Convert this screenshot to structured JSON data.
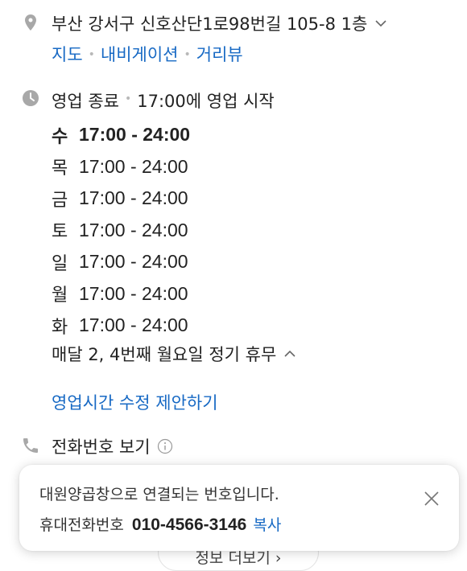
{
  "address": {
    "text": "부산 강서구 신호산단1로98번길 105-8 1층",
    "links": [
      "지도",
      "내비게이션",
      "거리뷰"
    ]
  },
  "business": {
    "status": "영업 종료",
    "next_open": "17:00에 영업 시작",
    "hours": [
      {
        "day": "수",
        "time": "17:00 - 24:00"
      },
      {
        "day": "목",
        "time": "17:00 - 24:00"
      },
      {
        "day": "금",
        "time": "17:00 - 24:00"
      },
      {
        "day": "토",
        "time": "17:00 - 24:00"
      },
      {
        "day": "일",
        "time": "17:00 - 24:00"
      },
      {
        "day": "월",
        "time": "17:00 - 24:00"
      },
      {
        "day": "화",
        "time": "17:00 - 24:00"
      }
    ],
    "closed_note": "매달 2, 4번째 월요일 정기 휴무",
    "suggest_edit": "영업시간 수정 제안하기"
  },
  "phone": {
    "label": "전화번호 보기"
  },
  "peek_button": {
    "label": "정보 더보기 ›"
  },
  "toast": {
    "message": "대원양곱창으로 연결되는 번호입니다.",
    "label": "휴대전화번호",
    "number": "010-4566-3146",
    "copy": "복사"
  },
  "colors": {
    "link": "#1769c4",
    "icon": "#a8a8a8",
    "text": "#222222"
  }
}
